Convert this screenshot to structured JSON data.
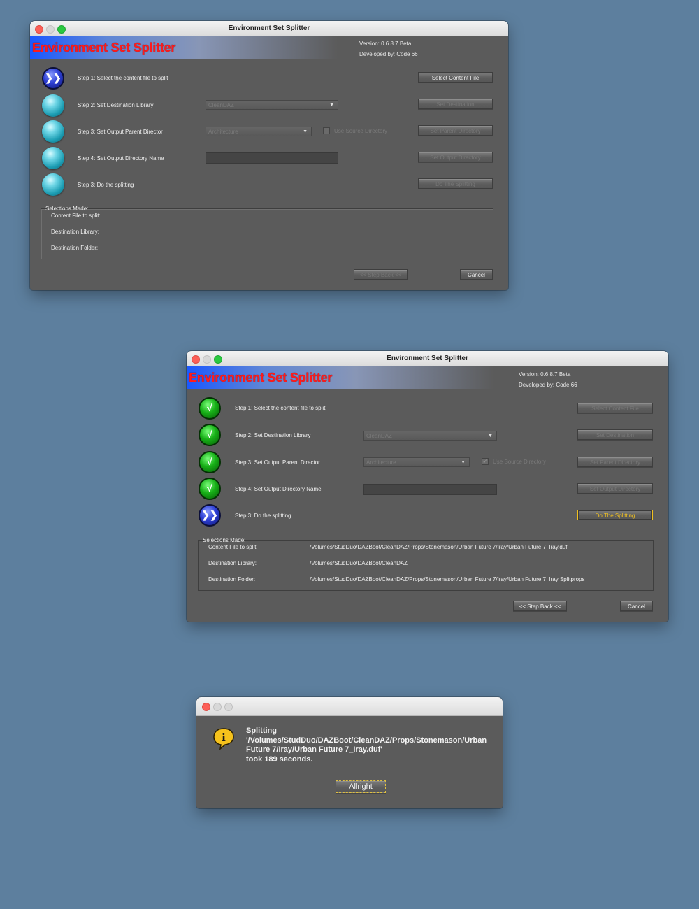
{
  "app": {
    "window_title": "Environment Set Splitter",
    "banner_title": "Environment Set Splitter",
    "version": "Version: 0.6.8.7 Beta",
    "developer": "Developed by: Code 66"
  },
  "steps": [
    {
      "label": "Step 1: Select the content file to split",
      "button": "Select Content File"
    },
    {
      "label": "Step 2: Set Destination Library",
      "button": "Set Destination",
      "combo_value": "CleanDAZ"
    },
    {
      "label": "Step 3: Set Output Parent Director",
      "button": "Set Parent Directory",
      "combo_value": "Architecture",
      "checkbox_label": "Use Source Directory"
    },
    {
      "label": "Step 4: Set Output Directory Name",
      "button": "Set Output Directory"
    },
    {
      "label": "Step 3: Do the splitting",
      "button": "Do The Splitting"
    }
  ],
  "selections": {
    "title": "Selections Made:",
    "content_label": "Content File to split:",
    "library_label": "Destination Library:",
    "folder_label": "Destination Folder:",
    "content_value": "/Volumes/StudDuo/DAZBoot/CleanDAZ/Props/Stonemason/Urban Future 7/Iray/Urban Future 7_Iray.duf",
    "library_value": "/Volumes/StudDuo/DAZBoot/CleanDAZ",
    "folder_value": "/Volumes/StudDuo/DAZBoot/CleanDAZ/Props/Stonemason/Urban Future 7/Iray/Urban Future 7_Iray Splitprops"
  },
  "footer": {
    "step_back": "<< Step Back <<",
    "cancel": "Cancel"
  },
  "icons": {
    "active_step": "double-chevron-icon",
    "done_step": "checkmark-icon",
    "pending_step": "orb-icon",
    "chevron_glyph": "❯❯",
    "check_glyph": "√",
    "combo_arrow_glyph": "▼",
    "checkbox_glyph": "✓",
    "dialog_icon": "info-icon",
    "dialog_icon_glyph": "i"
  },
  "dialog": {
    "line1": "Splitting",
    "line2": "'/Volumes/StudDuo/DAZBoot/CleanDAZ/Props/Stonemason/Urban",
    "line3": "Future 7/Iray/Urban Future 7_Iray.duf'",
    "line4": "took 189 seconds.",
    "button": "Allright"
  },
  "colors": {
    "desktop": "#5d7f9e",
    "window_bg": "#5b5b5b",
    "title_red": "#ff1b1b",
    "focus_yellow": "#f0c020"
  }
}
